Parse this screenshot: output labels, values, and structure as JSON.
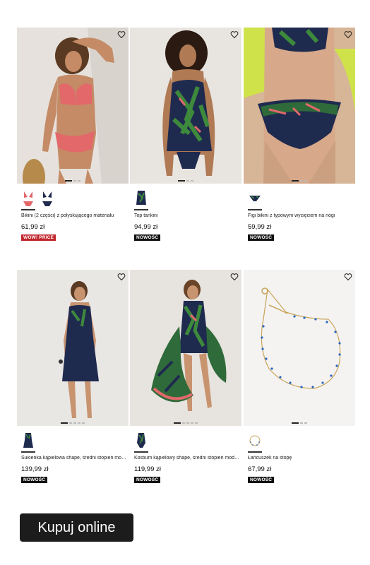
{
  "products": [
    {
      "name": "Bikini (2 części) z połyskującego materiału",
      "price": "61,99 zł",
      "badge": "WOW! PRICE",
      "badge_color": "#c0272d"
    },
    {
      "name": "Top tankini",
      "price": "94,99 zł",
      "badge": "NOWOŚĆ",
      "badge_color": "#111111"
    },
    {
      "name": "Figi bikini z typowym wycięciem na nogi",
      "price": "59,99 zł",
      "badge": "NOWOŚĆ",
      "badge_color": "#111111"
    },
    {
      "name": "Sukienka kąpielowa shape, średni stopień modelowania",
      "price": "139,99 zł",
      "badge": "NOWOŚĆ",
      "badge_color": "#111111"
    },
    {
      "name": "Kostium kąpielowy shape, średni stopień modelowania",
      "price": "119,99 zł",
      "badge": "NOWOŚĆ",
      "badge_color": "#111111"
    },
    {
      "name": "Łańcuszek na stopę",
      "price": "67,99 zł",
      "badge": "NOWOŚĆ",
      "badge_color": "#111111"
    }
  ],
  "cta_label": "Kupuj online",
  "icons": {
    "wishlist": "heart-outline-icon"
  },
  "colors": {
    "coral": "#e2686a",
    "navy": "#1f2a4f",
    "tropical_green": "#3e8a3c",
    "lime": "#cfe24a",
    "sale_red": "#c0272d"
  }
}
